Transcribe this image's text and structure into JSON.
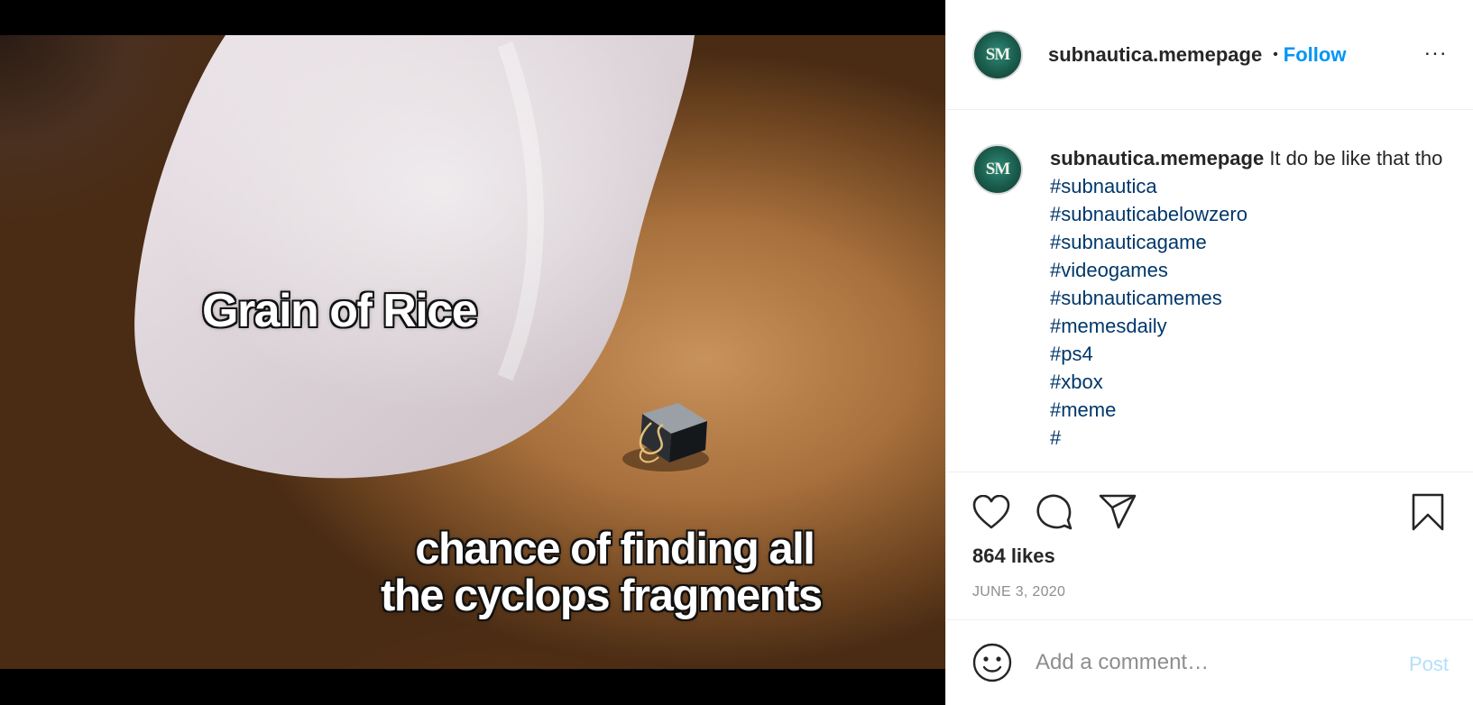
{
  "media": {
    "meme_top": "Grain of Rice",
    "meme_bottom_line1": "chance of finding all",
    "meme_bottom_line2": "the cyclops fragments"
  },
  "header": {
    "avatar_text": "SM",
    "username": "subnautica.memepage",
    "separator": "•",
    "follow_label": "Follow",
    "more_icon": "more-horizontal-icon",
    "more_glyph": "..."
  },
  "caption": {
    "username": "subnautica.memepage",
    "text": "It do be like that tho",
    "hashtags": [
      "#subnautica",
      "#subnauticabelowzero",
      "#subnauticagame",
      "#videogames",
      "#subnauticamemes",
      "#memesdaily",
      "#ps4",
      "#xbox",
      "#meme",
      "#"
    ]
  },
  "actions": {
    "icons": [
      "heart-icon",
      "comment-icon",
      "share-icon",
      "bookmark-icon"
    ],
    "likes": "864 likes",
    "date": "JUNE 3, 2020"
  },
  "comment_box": {
    "emoji_icon": "emoji-icon",
    "placeholder": "Add a comment…",
    "post_label": "Post"
  },
  "colors": {
    "link_blue": "#0095f6",
    "hashtag_blue": "#00376b",
    "post_disabled": "#b2dffc",
    "muted_gray": "#8e8e8e"
  }
}
